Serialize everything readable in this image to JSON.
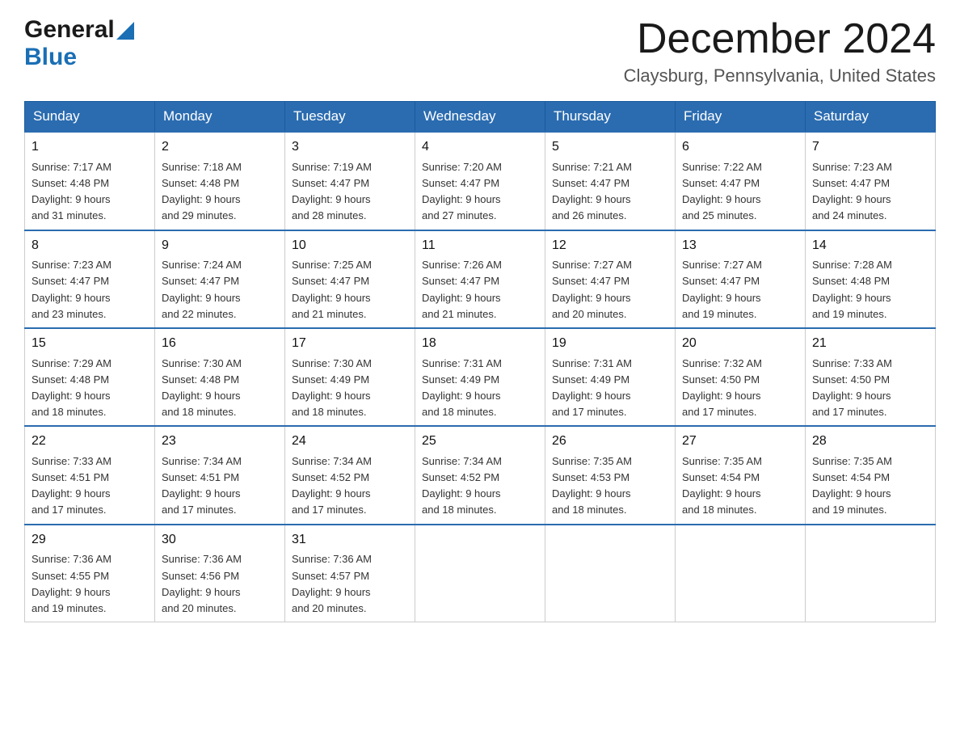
{
  "header": {
    "logo_general": "General",
    "logo_blue": "Blue",
    "month_title": "December 2024",
    "location": "Claysburg, Pennsylvania, United States"
  },
  "calendar": {
    "days_of_week": [
      "Sunday",
      "Monday",
      "Tuesday",
      "Wednesday",
      "Thursday",
      "Friday",
      "Saturday"
    ],
    "weeks": [
      [
        {
          "day": "1",
          "sunrise": "7:17 AM",
          "sunset": "4:48 PM",
          "daylight": "9 hours and 31 minutes."
        },
        {
          "day": "2",
          "sunrise": "7:18 AM",
          "sunset": "4:48 PM",
          "daylight": "9 hours and 29 minutes."
        },
        {
          "day": "3",
          "sunrise": "7:19 AM",
          "sunset": "4:47 PM",
          "daylight": "9 hours and 28 minutes."
        },
        {
          "day": "4",
          "sunrise": "7:20 AM",
          "sunset": "4:47 PM",
          "daylight": "9 hours and 27 minutes."
        },
        {
          "day": "5",
          "sunrise": "7:21 AM",
          "sunset": "4:47 PM",
          "daylight": "9 hours and 26 minutes."
        },
        {
          "day": "6",
          "sunrise": "7:22 AM",
          "sunset": "4:47 PM",
          "daylight": "9 hours and 25 minutes."
        },
        {
          "day": "7",
          "sunrise": "7:23 AM",
          "sunset": "4:47 PM",
          "daylight": "9 hours and 24 minutes."
        }
      ],
      [
        {
          "day": "8",
          "sunrise": "7:23 AM",
          "sunset": "4:47 PM",
          "daylight": "9 hours and 23 minutes."
        },
        {
          "day": "9",
          "sunrise": "7:24 AM",
          "sunset": "4:47 PM",
          "daylight": "9 hours and 22 minutes."
        },
        {
          "day": "10",
          "sunrise": "7:25 AM",
          "sunset": "4:47 PM",
          "daylight": "9 hours and 21 minutes."
        },
        {
          "day": "11",
          "sunrise": "7:26 AM",
          "sunset": "4:47 PM",
          "daylight": "9 hours and 21 minutes."
        },
        {
          "day": "12",
          "sunrise": "7:27 AM",
          "sunset": "4:47 PM",
          "daylight": "9 hours and 20 minutes."
        },
        {
          "day": "13",
          "sunrise": "7:27 AM",
          "sunset": "4:47 PM",
          "daylight": "9 hours and 19 minutes."
        },
        {
          "day": "14",
          "sunrise": "7:28 AM",
          "sunset": "4:48 PM",
          "daylight": "9 hours and 19 minutes."
        }
      ],
      [
        {
          "day": "15",
          "sunrise": "7:29 AM",
          "sunset": "4:48 PM",
          "daylight": "9 hours and 18 minutes."
        },
        {
          "day": "16",
          "sunrise": "7:30 AM",
          "sunset": "4:48 PM",
          "daylight": "9 hours and 18 minutes."
        },
        {
          "day": "17",
          "sunrise": "7:30 AM",
          "sunset": "4:49 PM",
          "daylight": "9 hours and 18 minutes."
        },
        {
          "day": "18",
          "sunrise": "7:31 AM",
          "sunset": "4:49 PM",
          "daylight": "9 hours and 18 minutes."
        },
        {
          "day": "19",
          "sunrise": "7:31 AM",
          "sunset": "4:49 PM",
          "daylight": "9 hours and 17 minutes."
        },
        {
          "day": "20",
          "sunrise": "7:32 AM",
          "sunset": "4:50 PM",
          "daylight": "9 hours and 17 minutes."
        },
        {
          "day": "21",
          "sunrise": "7:33 AM",
          "sunset": "4:50 PM",
          "daylight": "9 hours and 17 minutes."
        }
      ],
      [
        {
          "day": "22",
          "sunrise": "7:33 AM",
          "sunset": "4:51 PM",
          "daylight": "9 hours and 17 minutes."
        },
        {
          "day": "23",
          "sunrise": "7:34 AM",
          "sunset": "4:51 PM",
          "daylight": "9 hours and 17 minutes."
        },
        {
          "day": "24",
          "sunrise": "7:34 AM",
          "sunset": "4:52 PM",
          "daylight": "9 hours and 17 minutes."
        },
        {
          "day": "25",
          "sunrise": "7:34 AM",
          "sunset": "4:52 PM",
          "daylight": "9 hours and 18 minutes."
        },
        {
          "day": "26",
          "sunrise": "7:35 AM",
          "sunset": "4:53 PM",
          "daylight": "9 hours and 18 minutes."
        },
        {
          "day": "27",
          "sunrise": "7:35 AM",
          "sunset": "4:54 PM",
          "daylight": "9 hours and 18 minutes."
        },
        {
          "day": "28",
          "sunrise": "7:35 AM",
          "sunset": "4:54 PM",
          "daylight": "9 hours and 19 minutes."
        }
      ],
      [
        {
          "day": "29",
          "sunrise": "7:36 AM",
          "sunset": "4:55 PM",
          "daylight": "9 hours and 19 minutes."
        },
        {
          "day": "30",
          "sunrise": "7:36 AM",
          "sunset": "4:56 PM",
          "daylight": "9 hours and 20 minutes."
        },
        {
          "day": "31",
          "sunrise": "7:36 AM",
          "sunset": "4:57 PM",
          "daylight": "9 hours and 20 minutes."
        },
        null,
        null,
        null,
        null
      ]
    ],
    "labels": {
      "sunrise": "Sunrise:",
      "sunset": "Sunset:",
      "daylight": "Daylight:"
    }
  }
}
